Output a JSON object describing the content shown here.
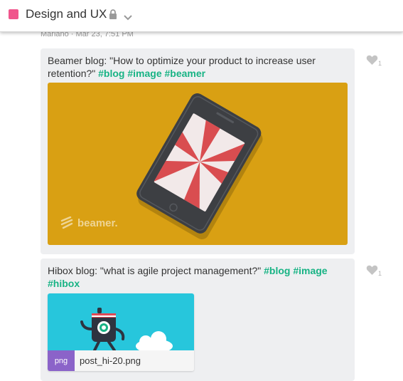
{
  "channel": {
    "title": "Design and UX",
    "color": "#f0558c",
    "lock_icon": "lock-icon",
    "dropdown_icon": "chevron-down-icon"
  },
  "partial_meta": "Mariano · Mar 23, 7:51 PM",
  "posts": [
    {
      "text_line1": "Beamer blog: \"How to optimize your product to increase user",
      "text_line2": "retention?\"",
      "tags": [
        "#blog",
        "#image",
        "#beamer"
      ],
      "like_count": "1",
      "preview": {
        "brand_text": "beamer.",
        "background": "#d9a013"
      }
    },
    {
      "text_line1": "Hibox blog: \"what is agile project management?\"",
      "tags_line1": [
        "#blog",
        "#image"
      ],
      "tags_line2": [
        "#hibox"
      ],
      "like_count": "1",
      "attachment": {
        "type": "png",
        "file_name": "post_hi-20.png"
      }
    }
  ],
  "colors": {
    "tag": "#17b384",
    "card_background": "#eeeff1",
    "file_badge": "#8b63c9"
  }
}
